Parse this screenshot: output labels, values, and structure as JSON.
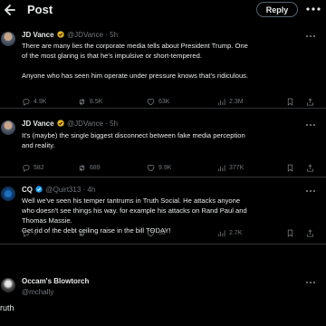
{
  "header": {
    "title": "Post",
    "reply_button": "Reply"
  },
  "tweets": [
    {
      "name": "JD Vance",
      "handle": "@JDVance · 5h",
      "lines": [
        "There are many lies the corporate media tells about President Trump. One",
        "of the most glaring is that he's impulsive or short-tempered.",
        "",
        "Anyone who has seen him operate under pressure knows that's ridiculous."
      ],
      "stats": {
        "replies": "4.9K",
        "reposts": "8.5K",
        "likes": "63K",
        "views": "2.3M"
      }
    },
    {
      "name": "JD Vance",
      "handle": "@JDVance · 5h",
      "lines": [
        "It's (maybe) the single biggest disconnect between fake media perception",
        "and reality."
      ],
      "stats": {
        "replies": "582",
        "reposts": "689",
        "likes": "9.9K",
        "views": "377K"
      }
    },
    {
      "name": "CQ",
      "handle": "@Quirt313 · 4h",
      "lines": [
        "Well we've seen his temper tantrums in Truth Social. He attacks anyone",
        "who doesn't see things his way. for example his attacks on Rand Paul and",
        "Thomas Massie.",
        "Get rid of the debt ceiling raise in the bill TODAY!"
      ],
      "stats": {
        "replies": "6",
        "reposts": "",
        "likes": "30",
        "views": "2.7K"
      }
    },
    {
      "name": "Occam's Blowtorch",
      "handle": "@mchally"
    }
  ],
  "reply_box": {
    "text": "ruth"
  },
  "colors": {
    "verified": "#e8b31d",
    "verified_blue": "#1d9bf0",
    "muted": "#71767b",
    "bg": "#000000"
  },
  "icons": [
    "back-arrow-icon",
    "more-icon",
    "reply-icon",
    "repost-icon",
    "like-icon",
    "views-icon",
    "bookmark-icon",
    "share-icon"
  ]
}
